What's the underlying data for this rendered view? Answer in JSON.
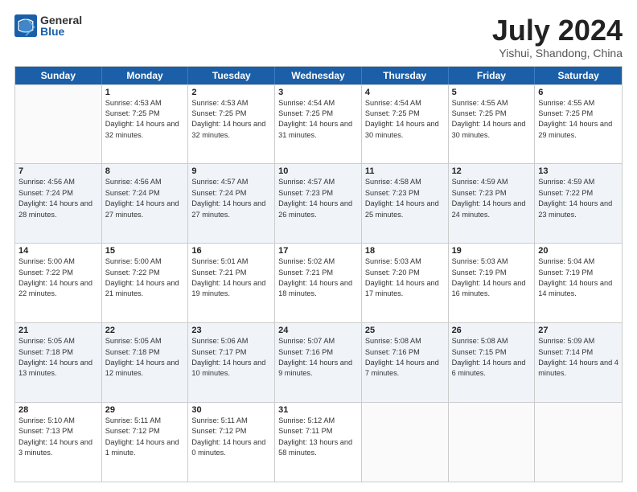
{
  "logo": {
    "general": "General",
    "blue": "Blue"
  },
  "header": {
    "month": "July 2024",
    "location": "Yishui, Shandong, China"
  },
  "days": [
    "Sunday",
    "Monday",
    "Tuesday",
    "Wednesday",
    "Thursday",
    "Friday",
    "Saturday"
  ],
  "rows": [
    [
      {
        "day": "",
        "sunrise": "",
        "sunset": "",
        "daylight": ""
      },
      {
        "day": "1",
        "sunrise": "Sunrise: 4:53 AM",
        "sunset": "Sunset: 7:25 PM",
        "daylight": "Daylight: 14 hours and 32 minutes."
      },
      {
        "day": "2",
        "sunrise": "Sunrise: 4:53 AM",
        "sunset": "Sunset: 7:25 PM",
        "daylight": "Daylight: 14 hours and 32 minutes."
      },
      {
        "day": "3",
        "sunrise": "Sunrise: 4:54 AM",
        "sunset": "Sunset: 7:25 PM",
        "daylight": "Daylight: 14 hours and 31 minutes."
      },
      {
        "day": "4",
        "sunrise": "Sunrise: 4:54 AM",
        "sunset": "Sunset: 7:25 PM",
        "daylight": "Daylight: 14 hours and 30 minutes."
      },
      {
        "day": "5",
        "sunrise": "Sunrise: 4:55 AM",
        "sunset": "Sunset: 7:25 PM",
        "daylight": "Daylight: 14 hours and 30 minutes."
      },
      {
        "day": "6",
        "sunrise": "Sunrise: 4:55 AM",
        "sunset": "Sunset: 7:25 PM",
        "daylight": "Daylight: 14 hours and 29 minutes."
      }
    ],
    [
      {
        "day": "7",
        "sunrise": "Sunrise: 4:56 AM",
        "sunset": "Sunset: 7:24 PM",
        "daylight": "Daylight: 14 hours and 28 minutes."
      },
      {
        "day": "8",
        "sunrise": "Sunrise: 4:56 AM",
        "sunset": "Sunset: 7:24 PM",
        "daylight": "Daylight: 14 hours and 27 minutes."
      },
      {
        "day": "9",
        "sunrise": "Sunrise: 4:57 AM",
        "sunset": "Sunset: 7:24 PM",
        "daylight": "Daylight: 14 hours and 27 minutes."
      },
      {
        "day": "10",
        "sunrise": "Sunrise: 4:57 AM",
        "sunset": "Sunset: 7:23 PM",
        "daylight": "Daylight: 14 hours and 26 minutes."
      },
      {
        "day": "11",
        "sunrise": "Sunrise: 4:58 AM",
        "sunset": "Sunset: 7:23 PM",
        "daylight": "Daylight: 14 hours and 25 minutes."
      },
      {
        "day": "12",
        "sunrise": "Sunrise: 4:59 AM",
        "sunset": "Sunset: 7:23 PM",
        "daylight": "Daylight: 14 hours and 24 minutes."
      },
      {
        "day": "13",
        "sunrise": "Sunrise: 4:59 AM",
        "sunset": "Sunset: 7:22 PM",
        "daylight": "Daylight: 14 hours and 23 minutes."
      }
    ],
    [
      {
        "day": "14",
        "sunrise": "Sunrise: 5:00 AM",
        "sunset": "Sunset: 7:22 PM",
        "daylight": "Daylight: 14 hours and 22 minutes."
      },
      {
        "day": "15",
        "sunrise": "Sunrise: 5:00 AM",
        "sunset": "Sunset: 7:22 PM",
        "daylight": "Daylight: 14 hours and 21 minutes."
      },
      {
        "day": "16",
        "sunrise": "Sunrise: 5:01 AM",
        "sunset": "Sunset: 7:21 PM",
        "daylight": "Daylight: 14 hours and 19 minutes."
      },
      {
        "day": "17",
        "sunrise": "Sunrise: 5:02 AM",
        "sunset": "Sunset: 7:21 PM",
        "daylight": "Daylight: 14 hours and 18 minutes."
      },
      {
        "day": "18",
        "sunrise": "Sunrise: 5:03 AM",
        "sunset": "Sunset: 7:20 PM",
        "daylight": "Daylight: 14 hours and 17 minutes."
      },
      {
        "day": "19",
        "sunrise": "Sunrise: 5:03 AM",
        "sunset": "Sunset: 7:19 PM",
        "daylight": "Daylight: 14 hours and 16 minutes."
      },
      {
        "day": "20",
        "sunrise": "Sunrise: 5:04 AM",
        "sunset": "Sunset: 7:19 PM",
        "daylight": "Daylight: 14 hours and 14 minutes."
      }
    ],
    [
      {
        "day": "21",
        "sunrise": "Sunrise: 5:05 AM",
        "sunset": "Sunset: 7:18 PM",
        "daylight": "Daylight: 14 hours and 13 minutes."
      },
      {
        "day": "22",
        "sunrise": "Sunrise: 5:05 AM",
        "sunset": "Sunset: 7:18 PM",
        "daylight": "Daylight: 14 hours and 12 minutes."
      },
      {
        "day": "23",
        "sunrise": "Sunrise: 5:06 AM",
        "sunset": "Sunset: 7:17 PM",
        "daylight": "Daylight: 14 hours and 10 minutes."
      },
      {
        "day": "24",
        "sunrise": "Sunrise: 5:07 AM",
        "sunset": "Sunset: 7:16 PM",
        "daylight": "Daylight: 14 hours and 9 minutes."
      },
      {
        "day": "25",
        "sunrise": "Sunrise: 5:08 AM",
        "sunset": "Sunset: 7:16 PM",
        "daylight": "Daylight: 14 hours and 7 minutes."
      },
      {
        "day": "26",
        "sunrise": "Sunrise: 5:08 AM",
        "sunset": "Sunset: 7:15 PM",
        "daylight": "Daylight: 14 hours and 6 minutes."
      },
      {
        "day": "27",
        "sunrise": "Sunrise: 5:09 AM",
        "sunset": "Sunset: 7:14 PM",
        "daylight": "Daylight: 14 hours and 4 minutes."
      }
    ],
    [
      {
        "day": "28",
        "sunrise": "Sunrise: 5:10 AM",
        "sunset": "Sunset: 7:13 PM",
        "daylight": "Daylight: 14 hours and 3 minutes."
      },
      {
        "day": "29",
        "sunrise": "Sunrise: 5:11 AM",
        "sunset": "Sunset: 7:12 PM",
        "daylight": "Daylight: 14 hours and 1 minute."
      },
      {
        "day": "30",
        "sunrise": "Sunrise: 5:11 AM",
        "sunset": "Sunset: 7:12 PM",
        "daylight": "Daylight: 14 hours and 0 minutes."
      },
      {
        "day": "31",
        "sunrise": "Sunrise: 5:12 AM",
        "sunset": "Sunset: 7:11 PM",
        "daylight": "Daylight: 13 hours and 58 minutes."
      },
      {
        "day": "",
        "sunrise": "",
        "sunset": "",
        "daylight": ""
      },
      {
        "day": "",
        "sunrise": "",
        "sunset": "",
        "daylight": ""
      },
      {
        "day": "",
        "sunrise": "",
        "sunset": "",
        "daylight": ""
      }
    ]
  ]
}
